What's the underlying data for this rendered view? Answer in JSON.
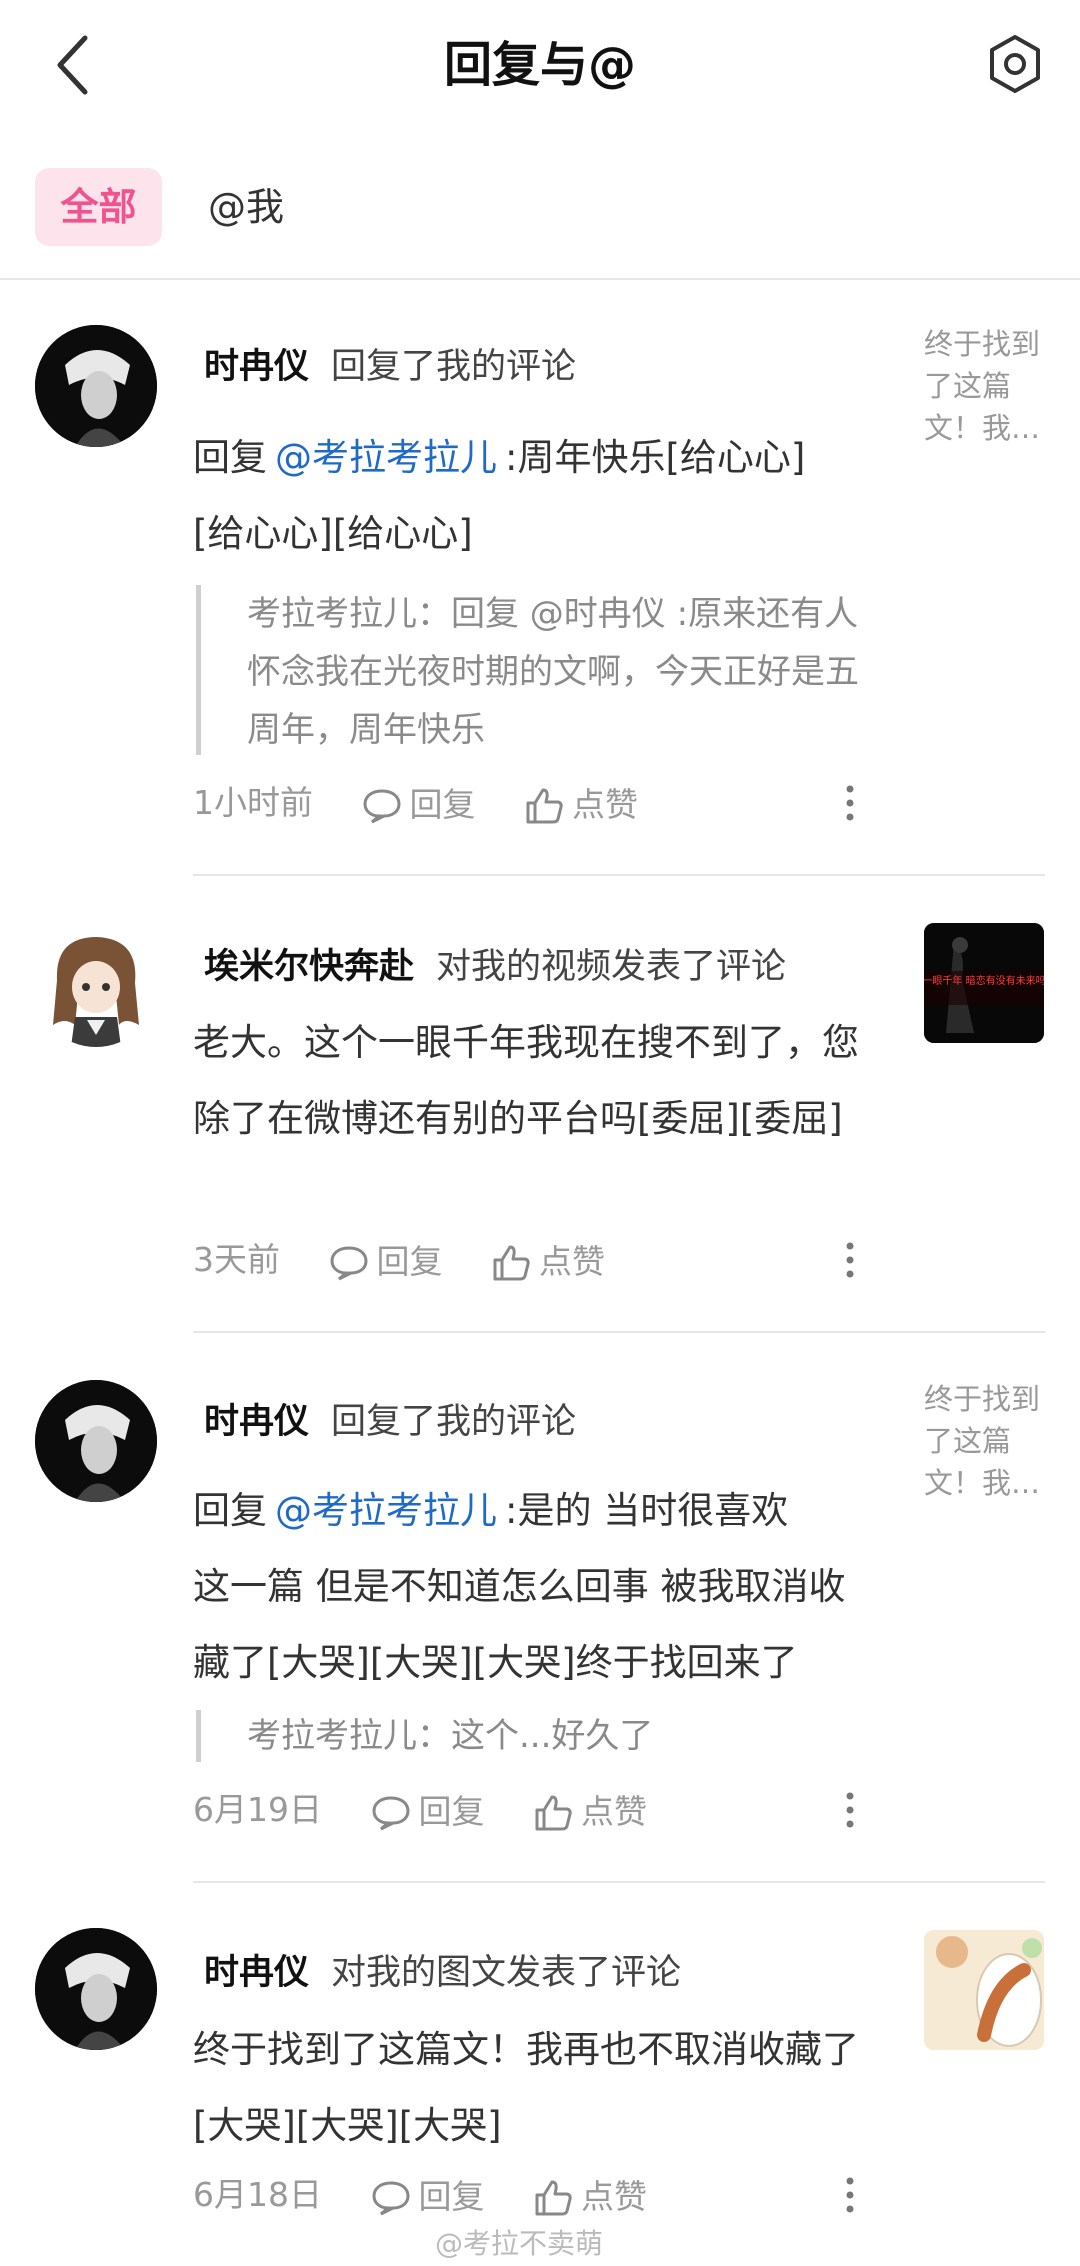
{
  "header": {
    "title": "回复与@"
  },
  "tabs": {
    "all": "全部",
    "at": "@我"
  },
  "colors": {
    "accent": "#f0538e",
    "mention": "#1f6ac6",
    "tab_bg": "#fde4ec"
  },
  "items": [
    {
      "user": "时冉仪",
      "action": "回复了我的评论",
      "prefix": "回复",
      "mention": "@考拉考拉儿",
      "text_line1": ":周年快乐[给心心]",
      "text_line2": "[给心心][给心心]",
      "quote": "考拉考拉儿：回复 @时冉仪 :原来还有人怀念我在光夜时期的文啊，今天正好是五周年，周年快乐",
      "time": "1小时前",
      "reply": "回复",
      "like": "点赞",
      "side": "终于找到了这篇文！我…"
    },
    {
      "user": "埃米尔快奔赴",
      "action": "对我的视频发表了评论",
      "text": "老大。这个一眼千年我现在搜不到了，您除了在微博还有别的平台吗[委屈][委屈]",
      "time": "3天前",
      "reply": "回复",
      "like": "点赞",
      "thumb_text": "一眼千年 暗恋有没有未来吗"
    },
    {
      "user": "时冉仪",
      "action": "回复了我的评论",
      "prefix": "回复",
      "mention": "@考拉考拉儿",
      "text_line1": ":是的 当时很喜欢",
      "text_rest": "这一篇 但是不知道怎么回事 被我取消收藏了[大哭][大哭][大哭]终于找回来了",
      "quote": "考拉考拉儿：这个...好久了",
      "time": "6月19日",
      "reply": "回复",
      "like": "点赞",
      "side": "终于找到了这篇文！我…"
    },
    {
      "user": "时冉仪",
      "action": "对我的图文发表了评论",
      "text": "终于找到了这篇文！我再也不取消收藏了[大哭][大哭][大哭]",
      "time": "6月18日",
      "reply": "回复",
      "like": "点赞"
    }
  ],
  "watermark": "@考拉不卖萌"
}
